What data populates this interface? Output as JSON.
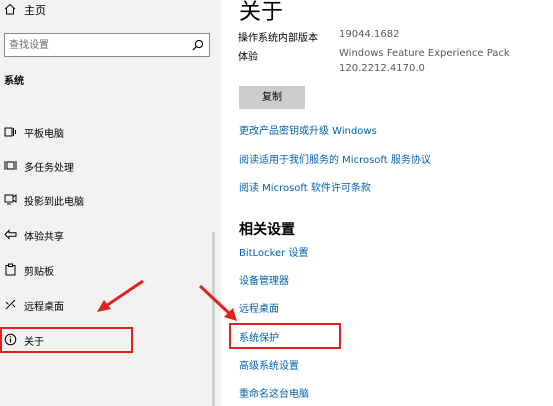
{
  "sidebar": {
    "home_label": "主页",
    "search_placeholder": "查找设置",
    "section_title": "系统",
    "items": [
      {
        "label": "平板电脑",
        "icon": "tablet-icon"
      },
      {
        "label": "多任务处理",
        "icon": "multitasking-icon"
      },
      {
        "label": "投影到此电脑",
        "icon": "projector-icon"
      },
      {
        "label": "体验共享",
        "icon": "share-experience-icon"
      },
      {
        "label": "剪贴板",
        "icon": "clipboard-icon"
      },
      {
        "label": "远程桌面",
        "icon": "remote-desktop-icon"
      },
      {
        "label": "关于",
        "icon": "info-icon",
        "selected": true
      }
    ]
  },
  "main": {
    "title": "关于",
    "build_label": "操作系统内部版本",
    "build_value": "19044.1682",
    "experience_label": "体验",
    "experience_value_line1": "Windows Feature Experience Pack",
    "experience_value_line2": "120.2212.4170.0",
    "copy_button": "复制",
    "links": [
      "更改产品密钥或升级 Windows",
      "阅读适用于我们服务的 Microsoft 服务协议",
      "阅读 Microsoft 软件许可条款"
    ],
    "related_heading": "相关设置",
    "related_links": [
      "BitLocker 设置",
      "设备管理器",
      "远程桌面",
      "系统保护",
      "高级系统设置",
      "重命名这台电脑"
    ]
  },
  "colors": {
    "accent_link": "#0063b1",
    "highlight_red": "#e0211c",
    "sidebar_bg": "#f2f2f2"
  }
}
